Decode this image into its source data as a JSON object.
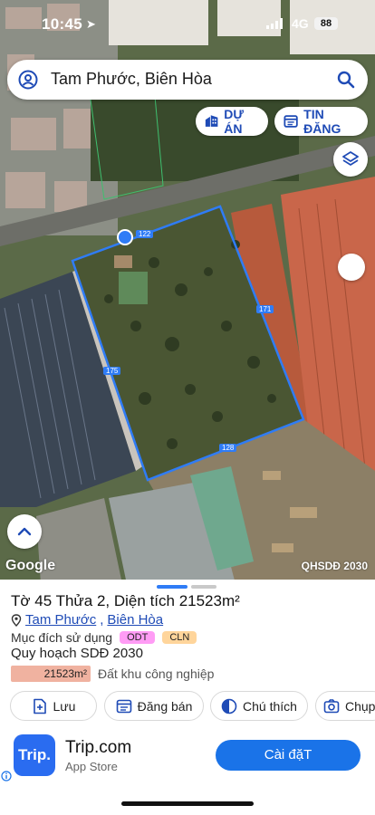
{
  "status_bar": {
    "time": "10:45",
    "network": "4G",
    "battery": "88"
  },
  "search": {
    "query": "Tam Phước, Biên Hòa"
  },
  "map_buttons": {
    "du_an": "DỰ ÁN",
    "tin_dang": "TIN ĐĂNG"
  },
  "parcel_edges": {
    "top": "122",
    "right": "171",
    "bottom": "128",
    "left": "175"
  },
  "map_footer": {
    "logo": "Google",
    "caption": "QHSDĐ 2030"
  },
  "parcel": {
    "title": "Tờ 45 Thửa 2, Diện tích 21523m²",
    "ward": "Tam Phước",
    "separator": ",",
    "city": "Biên Hòa",
    "purpose_label": "Mục đích sử dụng",
    "tags": [
      "ODT",
      "CLN"
    ],
    "plan_title": "Quy hoạch SDĐ 2030",
    "plan_area": "21523m²",
    "plan_type": "Đất khu công nghiệp"
  },
  "actions": {
    "save": "Lưu",
    "post": "Đăng bán",
    "note": "Chú thích",
    "capture": "Chụp"
  },
  "ad": {
    "logo_text": "Trip.",
    "app_name": "Trip.com",
    "store": "App Store",
    "install": "Cài đặT"
  },
  "colors": {
    "accent": "#1f4bb6",
    "boundary": "#2f7cf6",
    "install": "#1a73e8",
    "tag_odt": "#ff9cf5",
    "tag_cln": "#ffd59b",
    "area_chip": "#f0b2a0"
  }
}
